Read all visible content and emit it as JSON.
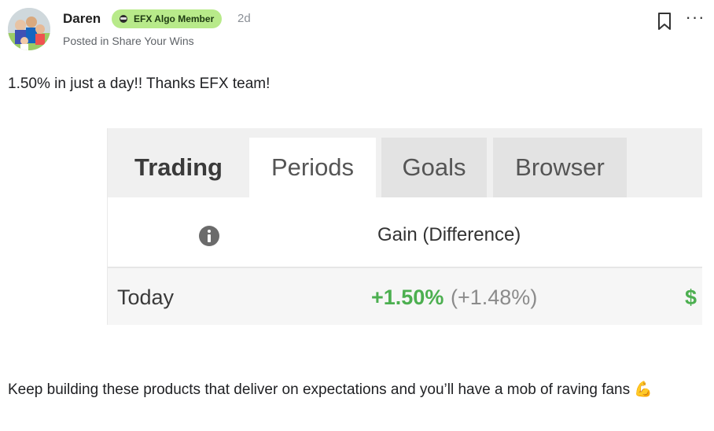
{
  "post": {
    "author": "Daren",
    "badge": "EFX Algo Member",
    "time_ago": "2d",
    "posted_in_label": "Posted in",
    "channel": "Share Your Wins",
    "body_top": "1.50% in just a day!! Thanks EFX team!",
    "body_bottom": "Keep building these products that deliver on expectations and you’ll have a mob of raving fans",
    "emoji": "💪",
    "more_label": "···"
  },
  "embed": {
    "tabs": [
      "Trading",
      "Periods",
      "Goals",
      "Browser"
    ],
    "active_tab": "Periods",
    "column_header": "Gain (Difference)",
    "row": {
      "label": "Today",
      "gain": "+1.50%",
      "difference": "(+1.48%)",
      "extra_cutoff": "$"
    }
  },
  "colors": {
    "badge_bg": "#b8ea8a",
    "gain_green": "#4caf50"
  },
  "icons": [
    "bookmark-icon",
    "more-icon",
    "info-icon",
    "badge-icon",
    "muscle-emoji"
  ]
}
